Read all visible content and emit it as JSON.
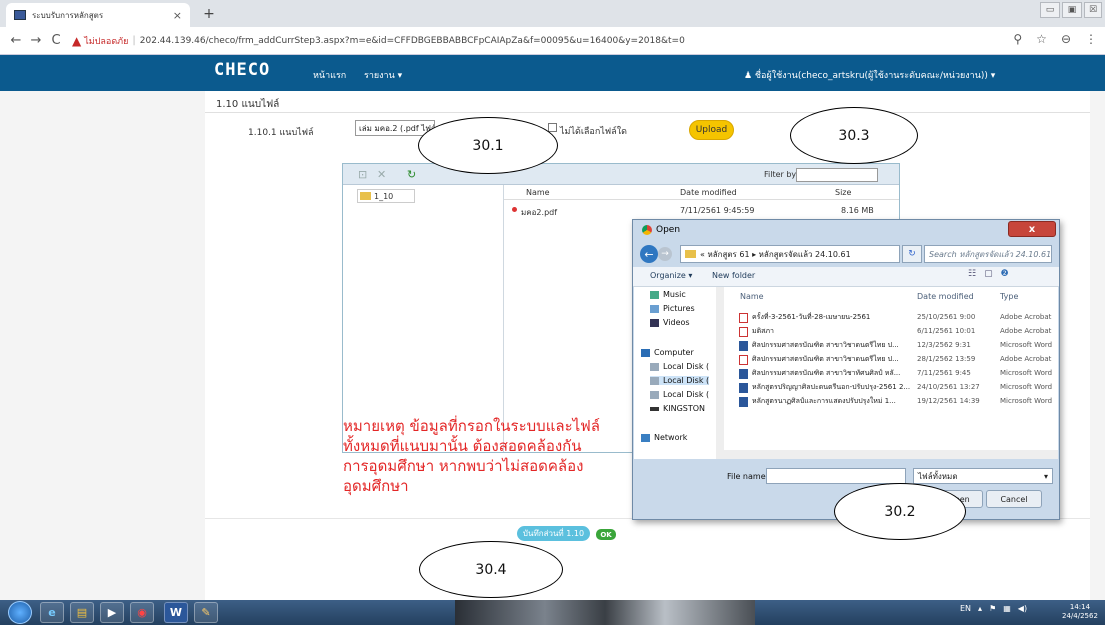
{
  "browser": {
    "tab_title": "ระบบรับการหลักสูตร",
    "tab_close": "×",
    "new_tab": "+",
    "insecure_label": "ไม่ปลอดภัย",
    "url": "202.44.139.46/checo/frm_addCurrStep3.aspx?m=e&id=CFFDBGEBBABBCFpCAIApZa&f=00095&u=16400&y=2018&t=0",
    "window_min": "▭",
    "window_max": "▣",
    "window_close": "☒"
  },
  "navbar": {
    "logo": "CHECO",
    "home": "หน้าแรก",
    "report": "รายงาน ▾",
    "user": "♟ ชื่อผู้ใช้งาน(checo_artskru(ผู้ใช้งานระดับคณะ/หน่วยงาน)) ▾"
  },
  "section": {
    "title": "1.10 แนบไฟล์",
    "file_label": "1.10.1 แนบไฟล์",
    "file_select": "เล่ม มคอ.2 (.pdf ไฟล์)",
    "no_file_label": "ไม่ได้เลือกไฟล์ใด",
    "upload": "Upload"
  },
  "file_manager": {
    "filter_label": "Filter by:",
    "folder": "1_10",
    "col_name": "Name",
    "col_date": "Date modified",
    "col_size": "Size",
    "file_name": "มคอ2.pdf",
    "file_date": "7/11/2561 9:45:59",
    "file_size": "8.16 MB"
  },
  "note": {
    "line1": "หมายเหตุ ข้อมูลที่กรอกในระบบและไฟล์",
    "line2": "ทั้งหมดที่แนบมานั้น ต้องสอดคล้องกัน",
    "line3": "การอุดมศึกษา หากพบว่าไม่สอดคล้อง",
    "line4": "อุดมศึกษา"
  },
  "save": {
    "label": "บันทึกส่วนที่ 1.10",
    "ok": "OK"
  },
  "dialog": {
    "title": "Open",
    "close": "x",
    "path": "« หลักสูตร 61 ▸ หลักสูตรจัดแล้ว 24.10.61",
    "search": "Search หลักสูตรจัดแล้ว 24.10.61",
    "organize": "Organize ▾",
    "new_folder": "New folder",
    "nav": [
      "Music",
      "Pictures",
      "Videos",
      "Computer",
      "Local Disk (",
      "Local Disk (",
      "Local Disk (",
      "KINGSTON",
      "Network"
    ],
    "col_name": "Name",
    "col_date": "Date modified",
    "col_type": "Type",
    "files": [
      {
        "name": "ครั้งที่-3-2561-วันที่-28-เมษายน-2561",
        "date": "25/10/2561 9:00",
        "type": "Adobe Acrobat"
      },
      {
        "name": "มติสภา",
        "date": "6/11/2561 10:01",
        "type": "Adobe Acrobat"
      },
      {
        "name": "ศิลปกรรมศาสตรบัณฑิต สาขาวิชาดนตรีไทย ป...",
        "date": "12/3/2562 9:31",
        "type": "Microsoft Word"
      },
      {
        "name": "ศิลปกรรมศาสตรบัณฑิต สาขาวิชาดนตรีไทย ป...",
        "date": "28/1/2562 13:59",
        "type": "Adobe Acrobat"
      },
      {
        "name": "ศิลปกรรมศาสตรบัณฑิต สาขาวิชาทัศนศิลป์ หลั...",
        "date": "7/11/2561 9:45",
        "type": "Microsoft Word"
      },
      {
        "name": "หลักสูตรปริญญาศิลปะดนตรีนอก-ปรับปรุง-2561 2...",
        "date": "24/10/2561 13:27",
        "type": "Microsoft Word"
      },
      {
        "name": "หลักสูตรนาฏศิลป์และการแสดงปรับปรุงใหม่ 1...",
        "date": "19/12/2561 14:39",
        "type": "Microsoft Word"
      }
    ],
    "file_name_label": "File name:",
    "file_type": "ไฟล์ทั้งหมด",
    "open": "Open",
    "cancel": "Cancel"
  },
  "annotations": [
    "30.1",
    "30.2",
    "30.3",
    "30.4"
  ],
  "taskbar": {
    "lang": "EN",
    "time": "14:14",
    "date": "24/4/2562"
  }
}
